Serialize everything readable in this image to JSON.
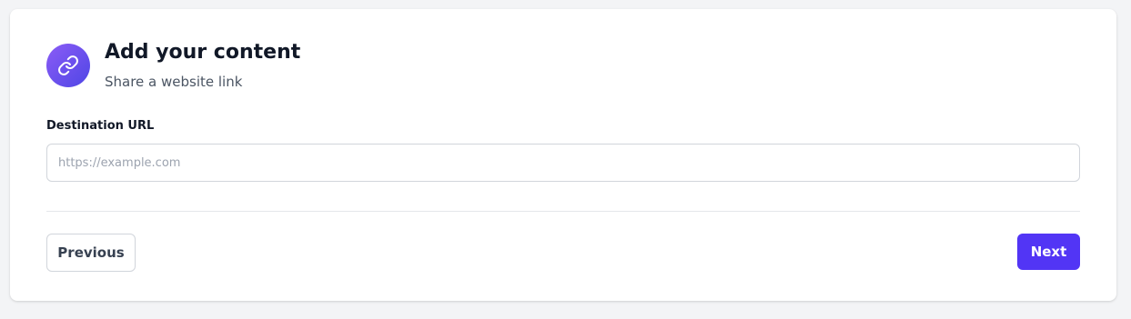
{
  "header": {
    "icon": "link-icon",
    "title": "Add your content",
    "subtitle": "Share a website link"
  },
  "form": {
    "url_label": "Destination URL",
    "url_value": "",
    "url_placeholder": "https://example.com"
  },
  "footer": {
    "previous_label": "Previous",
    "next_label": "Next"
  },
  "colors": {
    "accent": "#5235f5",
    "icon_gradient_start": "#8b5cf6",
    "icon_gradient_end": "#4f46e5",
    "page_background": "#f3f4f6"
  }
}
